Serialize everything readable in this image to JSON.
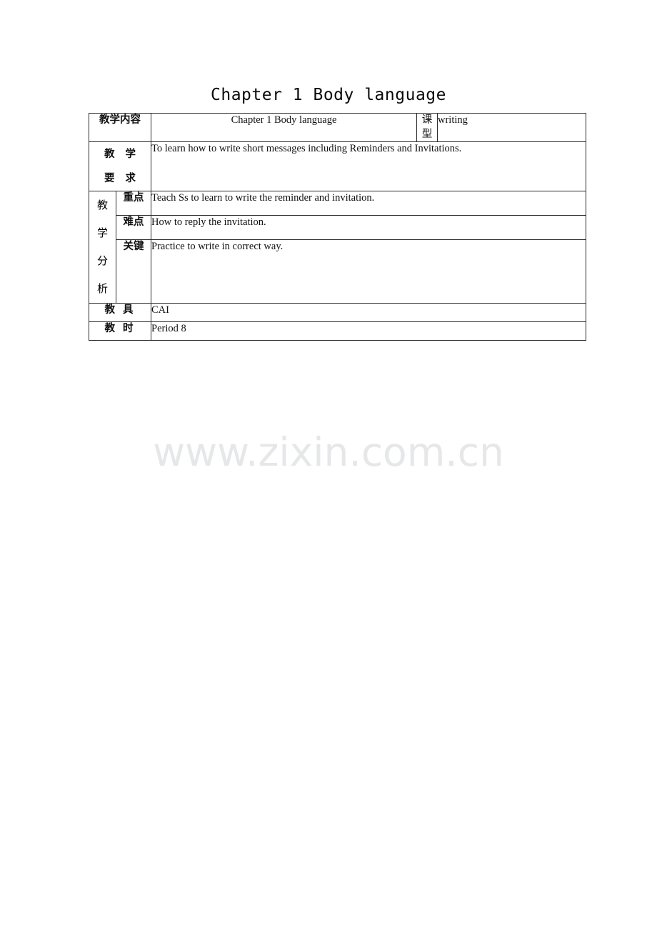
{
  "document": {
    "title": "Chapter 1 Body language",
    "watermark": "www.zixin.com.cn"
  },
  "table": {
    "rows": [
      {
        "label": "教学内容",
        "content": "Chapter 1 Body language",
        "sub_label": "课型",
        "sub_content": "writing"
      },
      {
        "label_line1": "教 学",
        "label_line2": "要 求",
        "content": "To learn how to write short messages including Reminders and Invitations."
      },
      {
        "group_label_chars": [
          "教",
          "学",
          "分",
          "析"
        ],
        "items": [
          {
            "sub_label": "重点",
            "content": "Teach Ss to learn to write the reminder and invitation."
          },
          {
            "sub_label": "难点",
            "content": "How to reply the invitation."
          },
          {
            "sub_label": "关键",
            "content": "Practice to write in correct way."
          }
        ]
      },
      {
        "label": "教 具",
        "content": " CAI"
      },
      {
        "label": "教 时",
        "content": "Period 8"
      }
    ]
  }
}
